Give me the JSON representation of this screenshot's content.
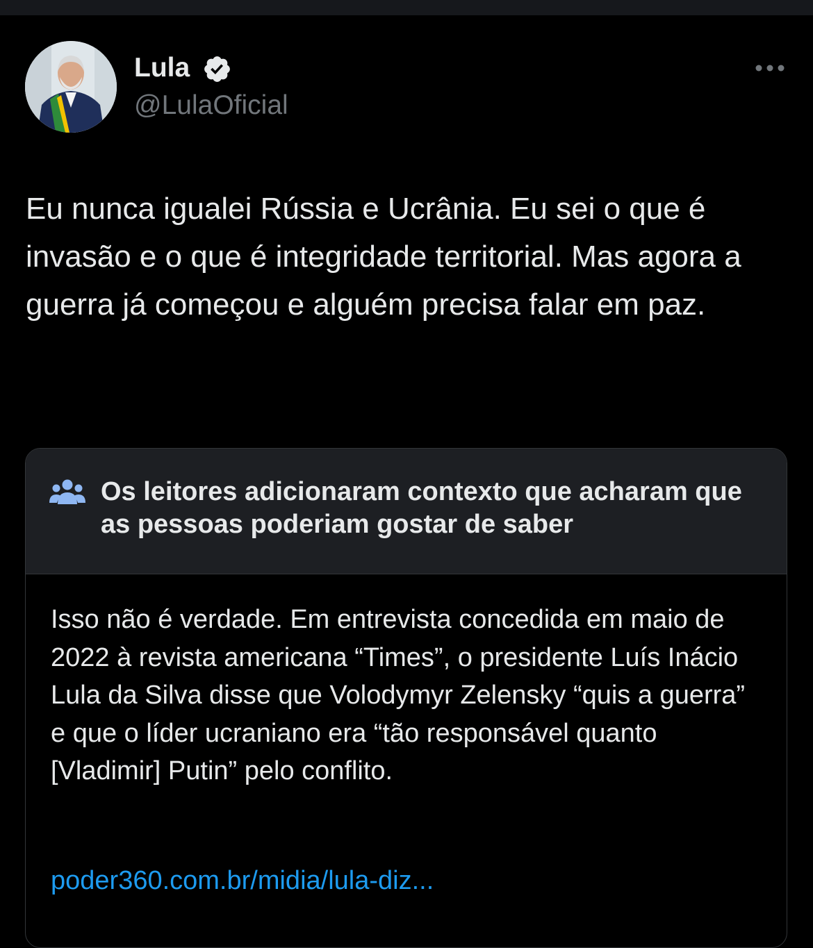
{
  "author": {
    "display_name": "Lula",
    "handle": "@LulaOficial",
    "verified": true
  },
  "tweet": {
    "text": "Eu nunca igualei Rússia e Ucrânia. Eu sei o que é invasão e o que é integridade territorial. Mas agora a guerra já começou e alguém precisa falar em paz."
  },
  "community_note": {
    "title": "Os leitores adicionaram contexto que acharam que as pessoas poderiam gostar de saber",
    "body": "Isso não é verdade. Em entrevista concedida em maio de 2022 à revista americana “Times”, o presidente Luís Inácio Lula da Silva disse que Volodymyr Zelensky “quis a guerra” e que o líder ucraniano era “tão responsável quanto [Vladimir] Putin” pelo conflito.",
    "link_text": "poder360.com.br/midia/lula-diz..."
  },
  "colors": {
    "background": "#000000",
    "text": "#e7e9ea",
    "muted": "#71767b",
    "accent": "#1d9bf0",
    "note_header_bg": "#1d1f23",
    "border": "#333639"
  },
  "icons": {
    "more": "more-horizontal-icon",
    "verified": "verified-badge-icon",
    "note": "people-icon"
  }
}
